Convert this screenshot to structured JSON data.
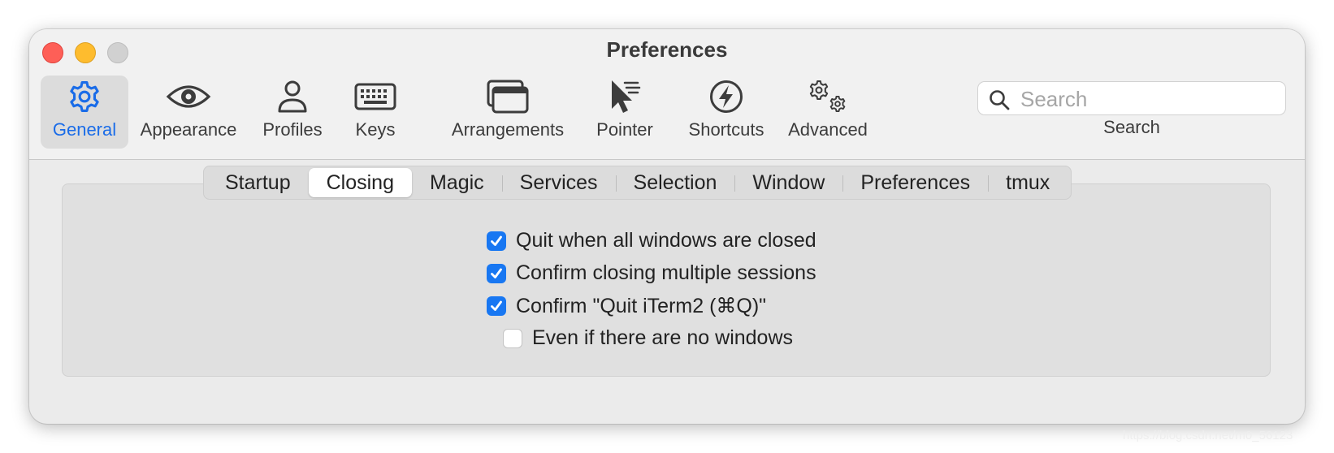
{
  "window": {
    "title": "Preferences"
  },
  "toolbar": {
    "items": [
      {
        "label": "General",
        "icon": "gear-icon",
        "active": true
      },
      {
        "label": "Appearance",
        "icon": "eye-icon"
      },
      {
        "label": "Profiles",
        "icon": "person-icon"
      },
      {
        "label": "Keys",
        "icon": "keyboard-icon"
      },
      {
        "label": "Arrangements",
        "icon": "windows-icon"
      },
      {
        "label": "Pointer",
        "icon": "cursor-icon"
      },
      {
        "label": "Shortcuts",
        "icon": "bolt-icon"
      },
      {
        "label": "Advanced",
        "icon": "gears-icon"
      }
    ],
    "search": {
      "placeholder": "Search",
      "value": "",
      "label": "Search"
    }
  },
  "tabs": [
    "Startup",
    "Closing",
    "Magic",
    "Services",
    "Selection",
    "Window",
    "Preferences",
    "tmux"
  ],
  "selected_tab": "Closing",
  "options": [
    {
      "label": "Quit when all windows are closed",
      "checked": true
    },
    {
      "label": "Confirm closing multiple sessions",
      "checked": true
    },
    {
      "label": "Confirm \"Quit iTerm2 (⌘Q)\"",
      "checked": true
    },
    {
      "label": "Even if there are no windows",
      "checked": false
    }
  ],
  "watermark": "https://blog.csdn.net/m0_56123",
  "colors": {
    "accent": "#1877f2",
    "close": "#fe5f57",
    "minimize": "#febc2e",
    "zoom": "#d1d1d1"
  }
}
